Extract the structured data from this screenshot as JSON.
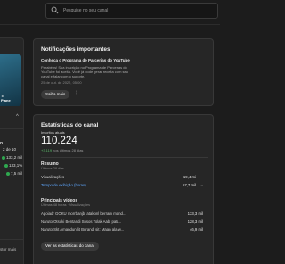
{
  "search": {
    "placeholder": "Pesquise no seu canal"
  },
  "left_panel": {
    "thumb_text_line1": "Ti",
    "thumb_text_line2": "Plane",
    "heading": "n",
    "rows": [
      {
        "text": "2 de 10",
        "top": 0
      },
      {
        "text": "133,2 mil",
        "top": 0
      },
      {
        "text": "133,1%",
        "top": 0
      },
      {
        "text": "7,5 mil",
        "top": 0
      }
    ],
    "bottom_text": "stor mais"
  },
  "notifications": {
    "title": "Notificações importantes",
    "item_title": "Conheça o Programa de Parcerias do YouTube",
    "item_body_lines": [
      "Parabéns! Sua inscrição no Programa de Parcerias do",
      "YouTube foi aceita. Você já pode gerar receita com seu",
      "canal e falar com o suporte."
    ],
    "item_date": "25 de out. de 2022, 05:00",
    "more_button": "Saiba mais",
    "kebab": "⋮"
  },
  "stats": {
    "title": "Estatísticas do canal",
    "subs_label": "Inscritos atuais",
    "subs_value": "110.224",
    "subs_delta_value": "+3.119",
    "subs_delta_rest": " nos últimos 28 dias",
    "summary_title": "Resumo",
    "summary_sub": "Últimos 28 dias",
    "summary_rows": [
      {
        "label": "Visualizações",
        "value": "19,4 mi",
        "dash": "–"
      },
      {
        "label": "Tempo de exibição (horas)",
        "value": "57,7 mil",
        "dash": "–"
      }
    ],
    "top_title": "Principais vídeos",
    "top_sub": "Últimas 48 horas · Visualizações",
    "top_rows": [
      {
        "label": "Apoiadr GOKU morrbanjbl atakonl berram mand...",
        "value": "133,3 mil"
      },
      {
        "label": "Naruto Otsuki Bentandi Snsos Tolak Aabl patr...",
        "value": "128,3 mil"
      },
      {
        "label": "Naruto Skt Amandun lit Burandi sit: Maan ala w...",
        "value": "46,9 mil"
      }
    ],
    "stats_button": "Ver as estatísticas do canal"
  },
  "colors": {
    "accent_green": "#5bbf6b",
    "card_bg": "#262626",
    "page_bg": "#1c1c1c"
  }
}
